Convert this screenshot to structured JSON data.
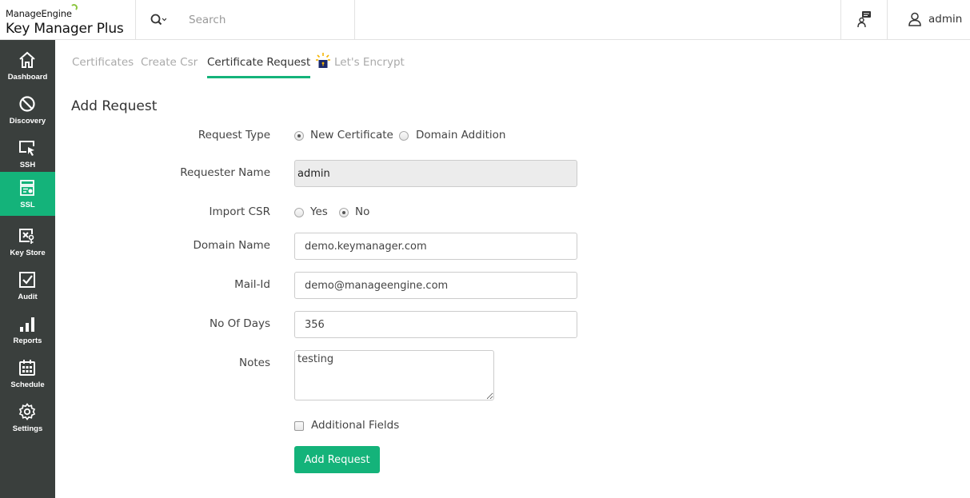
{
  "header": {
    "brand": "ManageEngine",
    "product": "Key Manager Plus",
    "search_placeholder": "Search",
    "user": "admin"
  },
  "sidebar": {
    "items": [
      {
        "label": "Dashboard",
        "icon": "home-icon",
        "active": false
      },
      {
        "label": "Discovery",
        "icon": "discovery-icon",
        "active": false
      },
      {
        "label": "SSH",
        "icon": "ssh-icon",
        "active": false
      },
      {
        "label": "SSL",
        "icon": "ssl-icon",
        "active": true
      },
      {
        "label": "Key Store",
        "icon": "key-store-icon",
        "active": false
      },
      {
        "label": "Audit",
        "icon": "audit-icon",
        "active": false
      },
      {
        "label": "Reports",
        "icon": "reports-icon",
        "active": false
      },
      {
        "label": "Schedule",
        "icon": "schedule-icon",
        "active": false
      },
      {
        "label": "Settings",
        "icon": "settings-icon",
        "active": false
      }
    ]
  },
  "tabs": [
    {
      "label": "Certificates",
      "active": false
    },
    {
      "label": "Create Csr",
      "active": false
    },
    {
      "label": "Certificate Request",
      "active": true
    },
    {
      "label": "Let's Encrypt",
      "active": false
    }
  ],
  "page_title": "Add Request",
  "form": {
    "request_type": {
      "label": "Request Type",
      "options": [
        "New Certificate",
        "Domain Addition"
      ],
      "selected": "New Certificate"
    },
    "requester_name": {
      "label": "Requester Name",
      "value": "admin"
    },
    "import_csr": {
      "label": "Import CSR",
      "options": [
        "Yes",
        "No"
      ],
      "selected": "No"
    },
    "domain_name": {
      "label": "Domain Name",
      "value": "demo.keymanager.com"
    },
    "mail_id": {
      "label": "Mail-Id",
      "value": "demo@manageengine.com"
    },
    "no_of_days": {
      "label": "No Of Days",
      "value": "356"
    },
    "notes": {
      "label": "Notes",
      "value": "testing"
    },
    "additional_fields": {
      "label": "Additional Fields",
      "checked": false
    },
    "submit_label": "Add Request"
  },
  "colors": {
    "accent": "#14b37a",
    "sidebar_bg": "#3a3f3d"
  }
}
